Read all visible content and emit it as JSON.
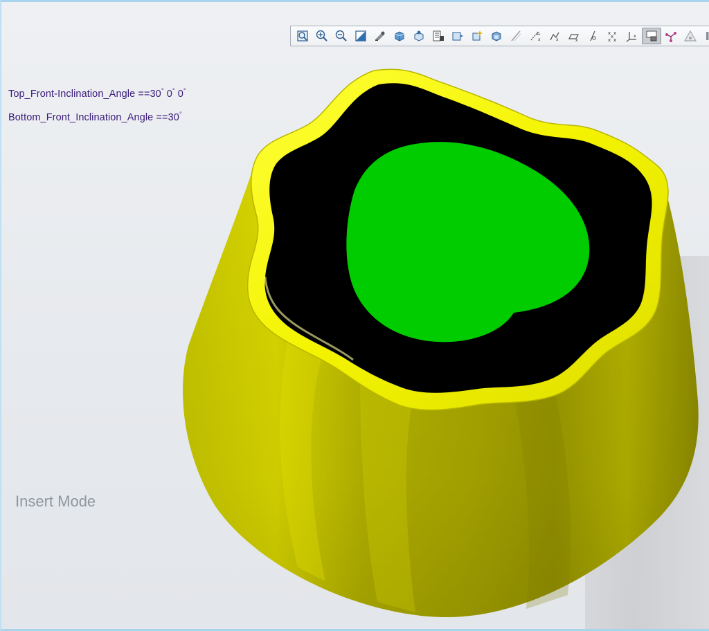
{
  "annotations": {
    "top_angle_label": "Top_Front-Inclination_Angle ==30",
    "top_angle_units": [
      "°",
      " 0",
      "°",
      " 0",
      "°"
    ],
    "bottom_angle_label": "Bottom_Front_Inclination_Angle ==30",
    "bottom_angle_unit": "°"
  },
  "status": {
    "mode": "Insert Mode"
  },
  "toolbar": {
    "icons": [
      "zoom-fit-icon",
      "zoom-in-icon",
      "zoom-out-icon",
      "repaint-icon",
      "display-style-icon",
      "shaded-view-icon",
      "saved-views-icon",
      "section-icon",
      "spin-center-icon",
      "annotation-display-icon",
      "appearance-icon",
      "datum-planes-icon",
      "datum-axes-icon",
      "datum-points-icon",
      "coordinate-systems-icon",
      "plane-tag-icon",
      "point-tag-icon",
      "csys-tag-icon",
      "model-tree-toggle-icon",
      "connection-icon",
      "warning-triangle-icon",
      "pause-icon"
    ],
    "active_index": 18
  },
  "model": {
    "body_color": "#c9c800",
    "rim_color": "#f2f200",
    "cavity_color": "#000000",
    "insert_color": "#00cc00"
  }
}
